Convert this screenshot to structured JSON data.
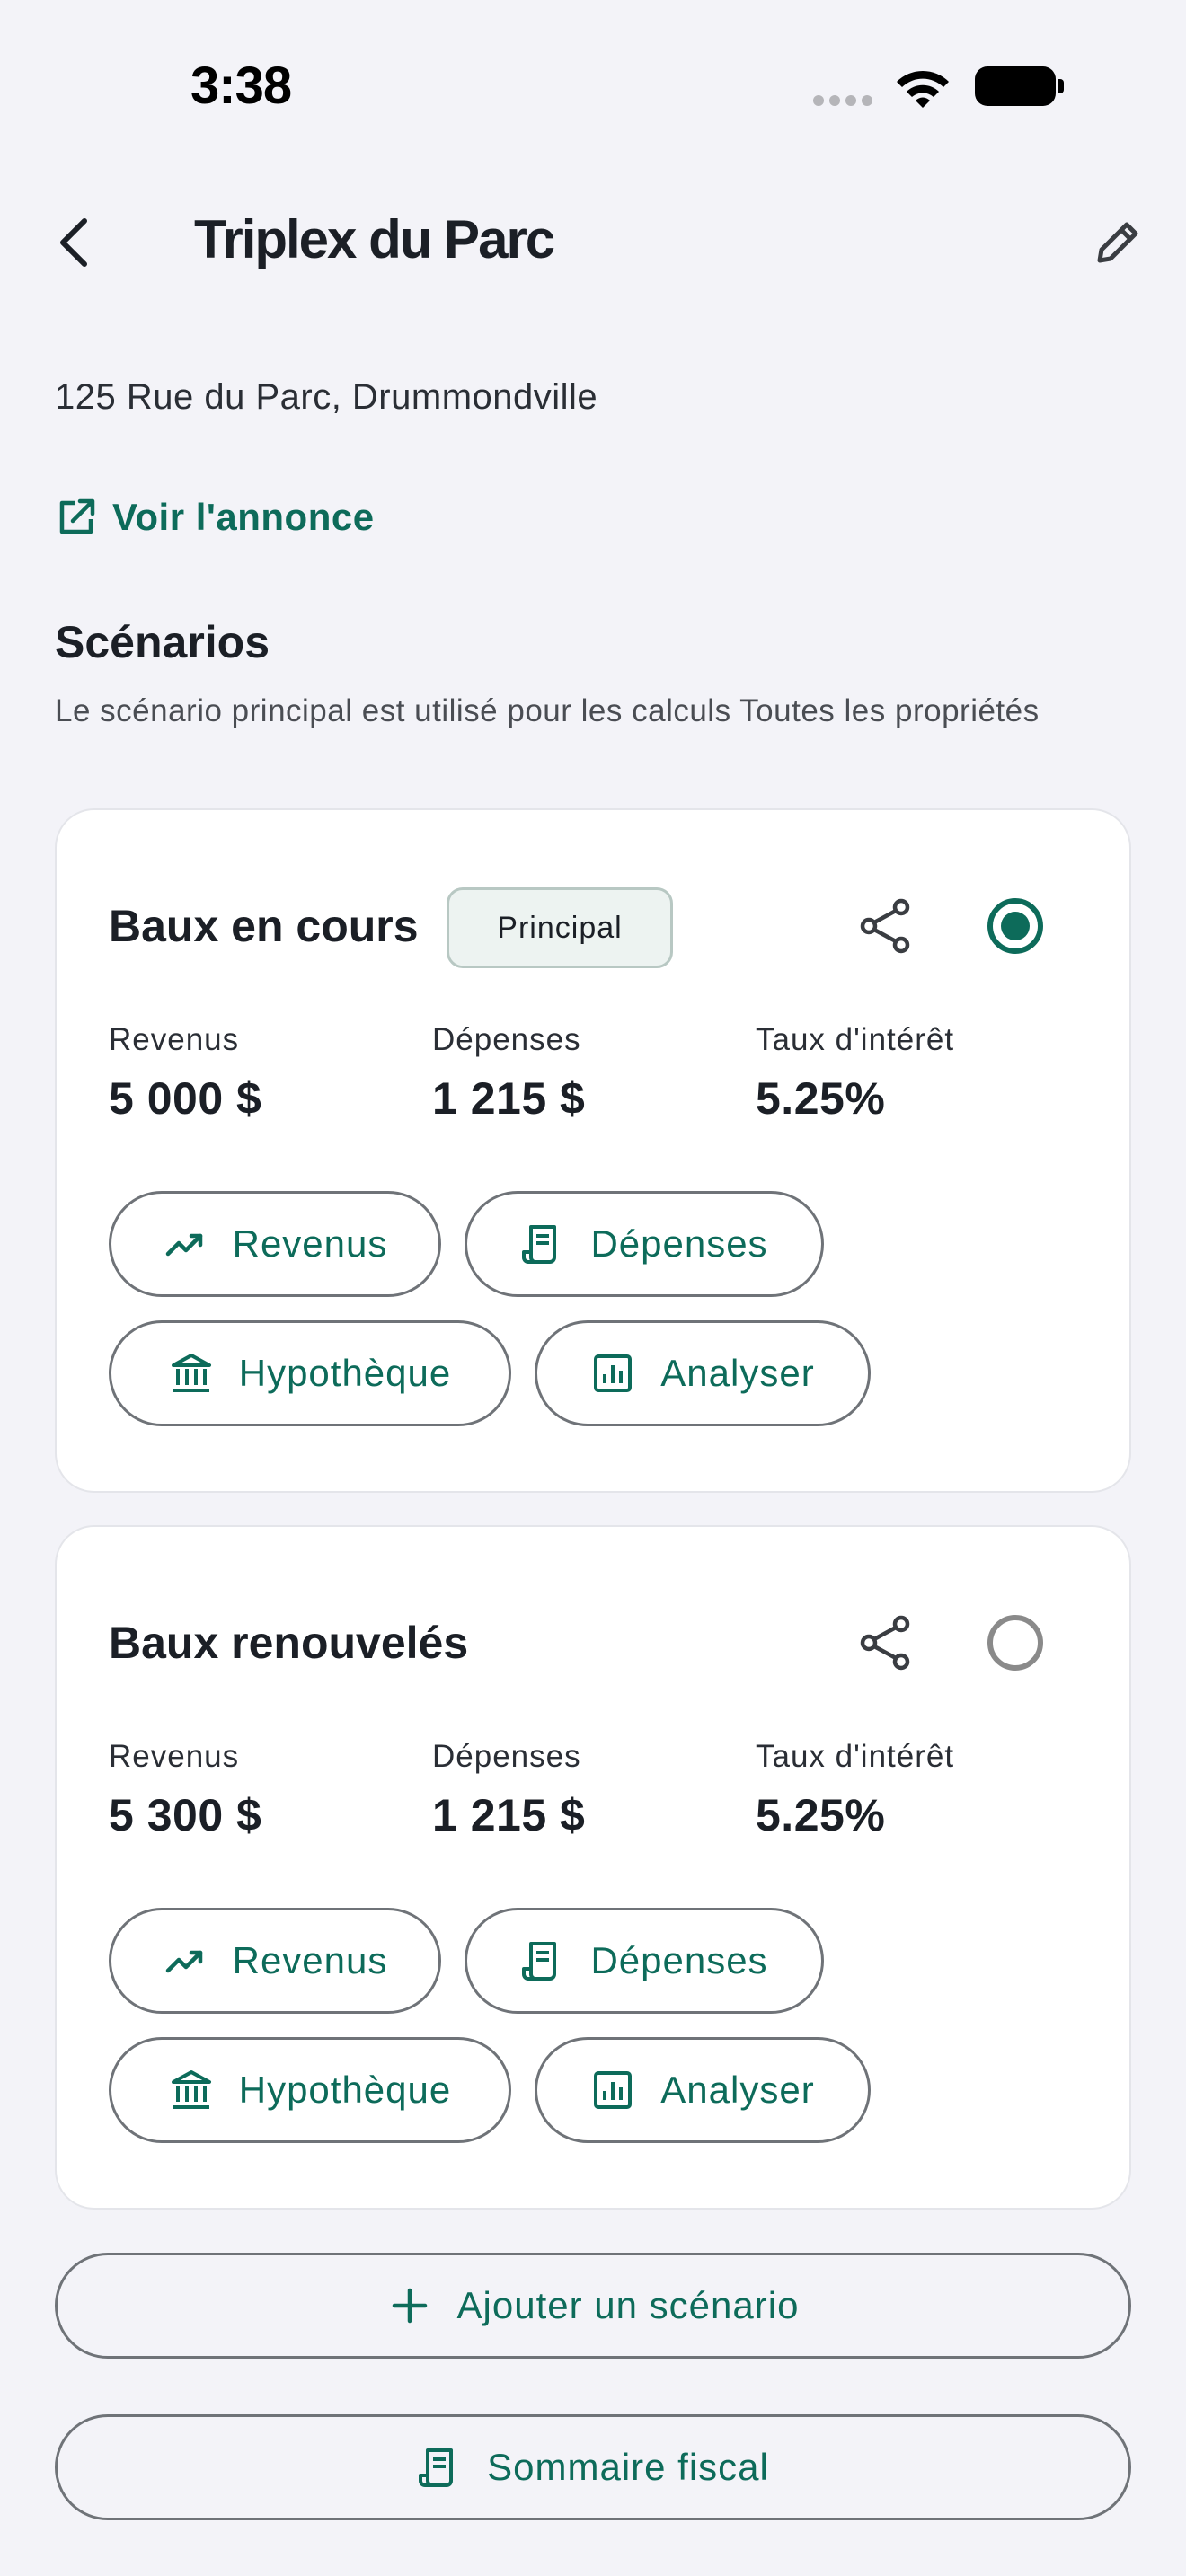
{
  "status_bar": {
    "time": "3:38"
  },
  "header": {
    "title": "Triplex du Parc"
  },
  "property": {
    "address": "125 Rue du Parc, Drummondville",
    "listing_link": "Voir l'annonce"
  },
  "scenarios_section": {
    "title": "Scénarios",
    "description": "Le scénario principal est utilisé pour les calculs Toutes les propriétés"
  },
  "scenarios": [
    {
      "name": "Baux en cours",
      "badge": "Principal",
      "selected": true,
      "stats": [
        {
          "label": "Revenus",
          "value": "5 000 $"
        },
        {
          "label": "Dépenses",
          "value": "1 215 $"
        },
        {
          "label": "Taux d'intérêt",
          "value": "5.25%"
        }
      ],
      "actions": {
        "revenus": "Revenus",
        "depenses": "Dépenses",
        "hypotheque": "Hypothèque",
        "analyser": "Analyser"
      }
    },
    {
      "name": "Baux renouvelés",
      "badge": "",
      "selected": false,
      "stats": [
        {
          "label": "Revenus",
          "value": "5 300 $"
        },
        {
          "label": "Dépenses",
          "value": "1 215 $"
        },
        {
          "label": "Taux d'intérêt",
          "value": "5.25%"
        }
      ],
      "actions": {
        "revenus": "Revenus",
        "depenses": "Dépenses",
        "hypotheque": "Hypothèque",
        "analyser": "Analyser"
      }
    }
  ],
  "footer_actions": {
    "add_scenario": "Ajouter un scénario",
    "tax_summary": "Sommaire fiscal"
  },
  "colors": {
    "accent": "#0d6b5a",
    "background": "#f3f3f8",
    "card": "#ffffff"
  },
  "icons": {
    "back": "chevron-left-icon",
    "edit": "pencil-icon",
    "link": "external-link-icon",
    "share": "share-icon",
    "revenus": "trending-up-icon",
    "depenses": "receipt-icon",
    "hypotheque": "bank-icon",
    "analyser": "bar-chart-icon",
    "add": "plus-icon",
    "tax": "receipt-icon"
  }
}
